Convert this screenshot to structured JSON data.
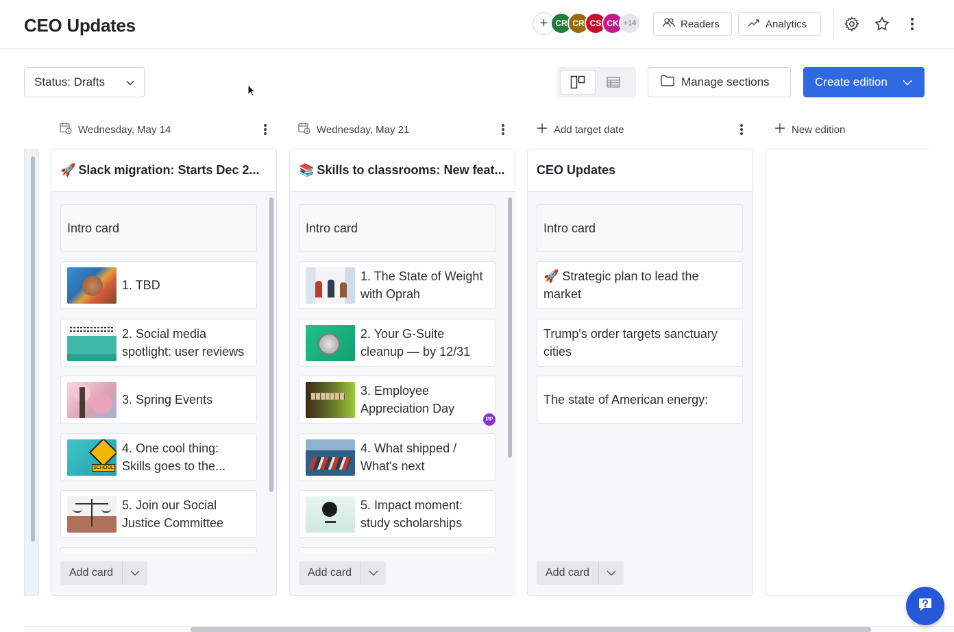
{
  "header": {
    "title": "CEO Updates",
    "avatars": [
      {
        "initials": "CR",
        "color": "#1a7f37"
      },
      {
        "initials": "CR",
        "color": "#9a6b0d"
      },
      {
        "initials": "CS",
        "color": "#c8102e"
      },
      {
        "initials": "CK",
        "color": "#c21c8c"
      }
    ],
    "more_count": "+14",
    "readers_label": "Readers",
    "analytics_label": "Analytics"
  },
  "toolbar": {
    "status_filter": "Status: Drafts",
    "manage_sections_label": "Manage sections",
    "create_edition_label": "Create edition"
  },
  "columns": [
    {
      "date": "Wednesday, May 14",
      "title_emoji": "🚀",
      "title": "Slack migration: Starts Dec 2...",
      "cards": [
        {
          "text": "Intro card",
          "intro": true
        },
        {
          "text": "1. TBD",
          "thumb": "hands"
        },
        {
          "text": "2. Social media spotlight: user reviews",
          "thumb": "social"
        },
        {
          "text": "3. Spring Events",
          "thumb": "blossom"
        },
        {
          "text": "4. One cool thing: Skills goes to the...",
          "thumb": "school"
        },
        {
          "text": "5. Join our Social Justice Committee",
          "thumb": "justice"
        }
      ],
      "add_card_label": "Add card"
    },
    {
      "date": "Wednesday, May 21",
      "title_emoji": "📚",
      "title": "Skills to classrooms: New feat...",
      "cards": [
        {
          "text": "Intro card",
          "intro": true
        },
        {
          "text": "1. The State of Weight with Oprah",
          "thumb": "oprah"
        },
        {
          "text": "2. Your G-Suite cleanup — by 12/31",
          "thumb": "coin"
        },
        {
          "text": "3. Employee Appreciation Day",
          "thumb": "thanks",
          "badge": "PP"
        },
        {
          "text": "4. What shipped / What's next",
          "thumb": "ship"
        },
        {
          "text": "5. Impact moment: study scholarships",
          "thumb": "scholar"
        }
      ],
      "add_card_label": "Add card"
    },
    {
      "date": "Add target date",
      "title_emoji": "",
      "title": "CEO Updates",
      "cards": [
        {
          "text": "Intro card",
          "intro": true
        },
        {
          "text": "🚀 Strategic plan to lead the market"
        },
        {
          "text": "Trump's order targets sanctuary cities"
        },
        {
          "text": "The state of American energy:"
        }
      ],
      "add_card_label": "Add card"
    }
  ],
  "new_edition_label": "New edition",
  "colors": {
    "accent": "#2f6ae3",
    "badge": "#8b2fd6",
    "help": "#2557d6"
  }
}
